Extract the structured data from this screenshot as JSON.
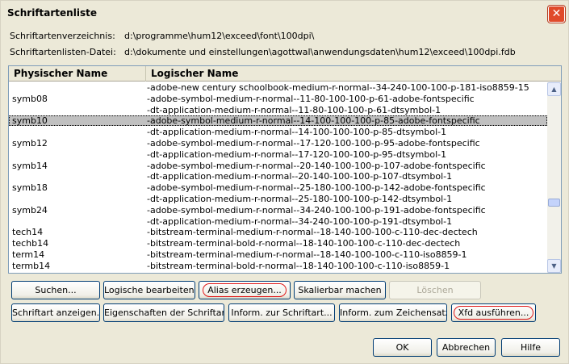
{
  "window": {
    "title": "Schriftartenliste",
    "close_glyph": "✕"
  },
  "info": {
    "dir_label": "Schriftartenverzeichnis:",
    "dir_value": "d:\\programme\\hum12\\exceed\\font\\100dpi\\",
    "file_label": "Schriftartenlisten-Datei:",
    "file_value": "d:\\dokumente und einstellungen\\agottwal\\anwendungsdaten\\hum12\\exceed\\100dpi.fdb"
  },
  "list": {
    "columns": [
      "Physischer Name",
      "Logischer Name"
    ],
    "rows": [
      {
        "physical": "",
        "logical": "-adobe-new century schoolbook-medium-r-normal--34-240-100-100-p-181-iso8859-15"
      },
      {
        "physical": "symb08",
        "logical": "-adobe-symbol-medium-r-normal--11-80-100-100-p-61-adobe-fontspecific"
      },
      {
        "physical": "",
        "logical": "-dt-application-medium-r-normal--11-80-100-100-p-61-dtsymbol-1"
      },
      {
        "physical": "symb10",
        "logical": "-adobe-symbol-medium-r-normal--14-100-100-100-p-85-adobe-fontspecific",
        "selected": true
      },
      {
        "physical": "",
        "logical": "-dt-application-medium-r-normal--14-100-100-100-p-85-dtsymbol-1"
      },
      {
        "physical": "symb12",
        "logical": "-adobe-symbol-medium-r-normal--17-120-100-100-p-95-adobe-fontspecific"
      },
      {
        "physical": "",
        "logical": "-dt-application-medium-r-normal--17-120-100-100-p-95-dtsymbol-1"
      },
      {
        "physical": "symb14",
        "logical": "-adobe-symbol-medium-r-normal--20-140-100-100-p-107-adobe-fontspecific"
      },
      {
        "physical": "",
        "logical": "-dt-application-medium-r-normal--20-140-100-100-p-107-dtsymbol-1"
      },
      {
        "physical": "symb18",
        "logical": "-adobe-symbol-medium-r-normal--25-180-100-100-p-142-adobe-fontspecific"
      },
      {
        "physical": "",
        "logical": "-dt-application-medium-r-normal--25-180-100-100-p-142-dtsymbol-1"
      },
      {
        "physical": "symb24",
        "logical": "-adobe-symbol-medium-r-normal--34-240-100-100-p-191-adobe-fontspecific"
      },
      {
        "physical": "",
        "logical": "-dt-application-medium-r-normal--34-240-100-100-p-191-dtsymbol-1"
      },
      {
        "physical": "tech14",
        "logical": "-bitstream-terminal-medium-r-normal--18-140-100-100-c-110-dec-dectech"
      },
      {
        "physical": "techb14",
        "logical": "-bitstream-terminal-bold-r-normal--18-140-100-100-c-110-dec-dectech"
      },
      {
        "physical": "term14",
        "logical": "-bitstream-terminal-medium-r-normal--18-140-100-100-c-110-iso8859-1"
      },
      {
        "physical": "termb14",
        "logical": "-bitstream-terminal-bold-r-normal--18-140-100-100-c-110-iso8859-1"
      }
    ]
  },
  "buttons": {
    "search": "Suchen...",
    "edit_logical": "Logische bearbeiten...",
    "create_alias": "Alias erzeugen...",
    "scalable": "Skalierbar machen",
    "delete": "Löschen",
    "show_font": "Schriftart anzeigen...",
    "font_properties": "Eigenschaften der Schriftart...",
    "font_info": "Inform. zur Schriftart...",
    "charset_info": "Inform. zum Zeichensatz...",
    "run_xfd": "Xfd ausführen...",
    "ok": "OK",
    "cancel": "Abbrechen",
    "help": "Hilfe"
  },
  "scrollbar": {
    "up_glyph": "▲",
    "down_glyph": "▼",
    "position": 0.66
  }
}
